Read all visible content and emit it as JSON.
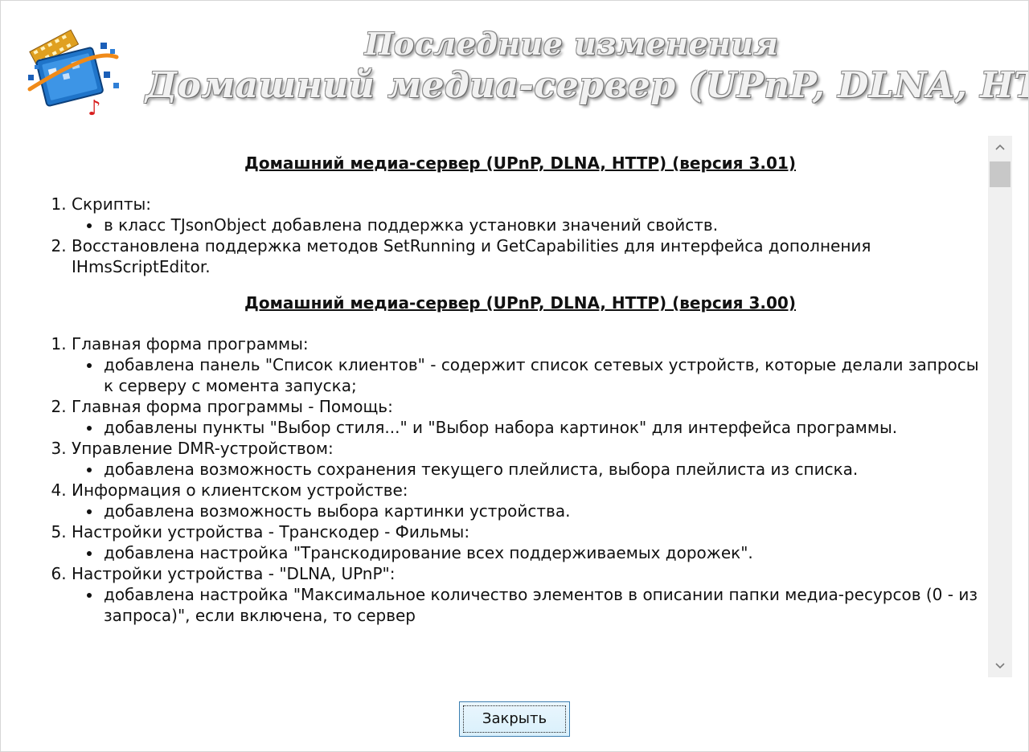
{
  "header": {
    "title_line1": "Последние изменения",
    "title_line2": "Домашний медиа-сервер (UPnP, DLNA, HTTP)",
    "logo_icon": "media-server-logo-icon"
  },
  "sections": [
    {
      "title": "Домашний медиа-сервер (UPnP, DLNA, HTTP) (версия 3.01)",
      "items": [
        {
          "label": "Скрипты:",
          "bullets": [
            "в класс TJsonObject добавлена поддержка установки значений свойств."
          ]
        },
        {
          "label": "Восстановлена поддержка методов SetRunning и GetCapabilities для интерфейса дополнения IHmsScriptEditor.",
          "bullets": []
        }
      ]
    },
    {
      "title": "Домашний медиа-сервер (UPnP, DLNA, HTTP) (версия 3.00)",
      "items": [
        {
          "label": "Главная форма программы:",
          "bullets": [
            "добавлена панель \"Список клиентов\" - содержит список сетевых устройств, которые делали запросы к серверу с момента запуска;"
          ]
        },
        {
          "label": "Главная форма программы - Помощь:",
          "bullets": [
            "добавлены пункты \"Выбор стиля...\" и \"Выбор набора картинок\" для интерфейса программы."
          ]
        },
        {
          "label": "Управление DMR-устройством:",
          "bullets": [
            "добавлена возможность сохранения текущего плейлиста, выбора плейлиста из списка."
          ]
        },
        {
          "label": "Информация о клиентском устройстве:",
          "bullets": [
            "добавлена возможность выбора картинки устройства."
          ]
        },
        {
          "label": "Настройки устройства - Транскодер - Фильмы:",
          "bullets": [
            "добавлена настройка \"Транскодирование всех поддерживаемых дорожек\"."
          ]
        },
        {
          "label": "Настройки устройства - \"DLNA, UPnP\":",
          "bullets": [
            "добавлена настройка \"Максимальное количество элементов в описании папки медиа-ресурсов (0 - из запроса)\", если включена, то сервер"
          ]
        }
      ]
    }
  ],
  "scrollbar": {
    "up_icon": "chevron-up-icon",
    "down_icon": "chevron-down-icon"
  },
  "footer": {
    "close_label": "Закрыть"
  }
}
